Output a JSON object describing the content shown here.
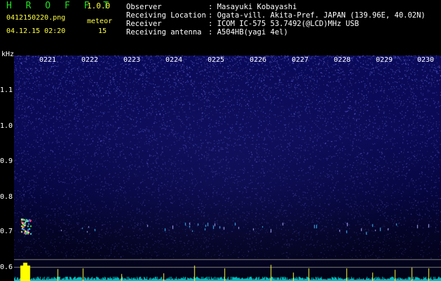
{
  "header": {
    "app_name": "H R O F F T",
    "version": "1.0.0",
    "filename": "0412150220.png",
    "meteor_label": "meteor",
    "meteor_count": "15",
    "datetime": "04.12.15 02:20"
  },
  "station": {
    "observer_label": "Observer",
    "observer_value": ": Masayuki Kobayashi",
    "location_label": "Receiving Location",
    "location_value": ": Ogata-vill. Akita-Pref. JAPAN (139.96E, 40.02N)",
    "receiver_label": "Receiver",
    "receiver_value": ": ICOM IC-575 53.7492(@LCD)MHz USB",
    "antenna_label": "Receiving antenna",
    "antenna_value": ": A504HB(yagi 4el)"
  },
  "axes": {
    "y_unit": "kHz",
    "y_ticks": [
      "1.1",
      "1.0",
      "0.9",
      "0.8",
      "0.7",
      "0.6"
    ],
    "x_ticks": [
      "0221",
      "0222",
      "0223",
      "0224",
      "0225",
      "0226",
      "0227",
      "0228",
      "0229",
      "0230"
    ]
  },
  "colors": {
    "green": "#20e020",
    "yellow": "#ffff40",
    "spectrogram_bg": "#0a0a5a",
    "baseline": "#00c0c0"
  }
}
